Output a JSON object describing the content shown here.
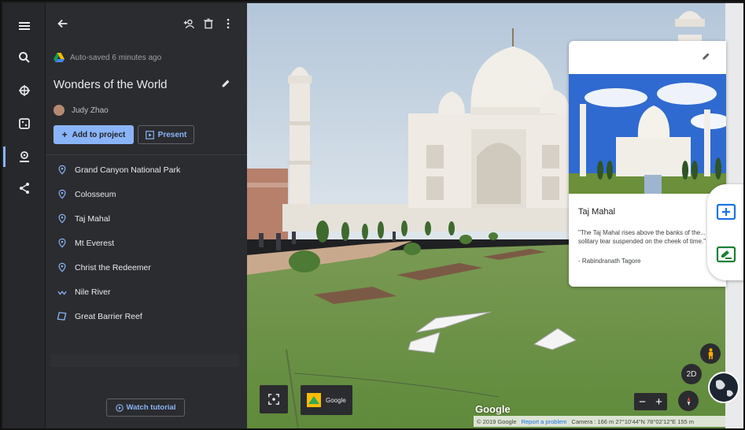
{
  "rail": {
    "items": [
      {
        "icon": "menu-icon"
      },
      {
        "icon": "search-icon"
      },
      {
        "icon": "voyager-icon"
      },
      {
        "icon": "dice-icon"
      },
      {
        "icon": "projects-icon"
      },
      {
        "icon": "share-icon"
      }
    ]
  },
  "panel": {
    "autosave_text": "Auto-saved 6 minutes ago",
    "title": "Wonders of the World",
    "author": "Judy Zhao",
    "add_label": "Add to project",
    "present_label": "Present",
    "places": [
      {
        "label": "Grand Canyon National Park",
        "icon": "place-pin-icon"
      },
      {
        "label": "Colosseum",
        "icon": "place-pin-icon"
      },
      {
        "label": "Taj Mahal",
        "icon": "place-pin-icon"
      },
      {
        "label": "Mt Everest",
        "icon": "place-pin-icon"
      },
      {
        "label": "Christ the Redeemer",
        "icon": "place-pin-icon"
      },
      {
        "label": "Nile River",
        "icon": "line-path-icon"
      },
      {
        "label": "Great Barrier Reef",
        "icon": "polygon-shape-icon"
      }
    ],
    "tutorial_label": "Watch tutorial"
  },
  "card": {
    "title": "Taj Mahal",
    "quote": "\"The Taj Mahal rises above the banks of the... like a solitary tear suspended on the cheek of time.\"",
    "cite": "- Rabindranath Tagore"
  },
  "controls": {
    "google_chip_label": "Google",
    "mode_2d_label": "2D",
    "zoom_out": "−",
    "zoom_in": "+",
    "google_logo": "Google",
    "copyright": "© 2019 Google",
    "report_link": "Report a problem",
    "camera_text": "Camera : 166 m  27°10'44\"N 78°02'12\"E  155 m"
  },
  "colors": {
    "accent": "#8ab4f8",
    "panel_bg": "#2b2c2f",
    "rail_bg": "#26282b",
    "fab_blue": "#1a73e8",
    "fab_green": "#188038"
  }
}
